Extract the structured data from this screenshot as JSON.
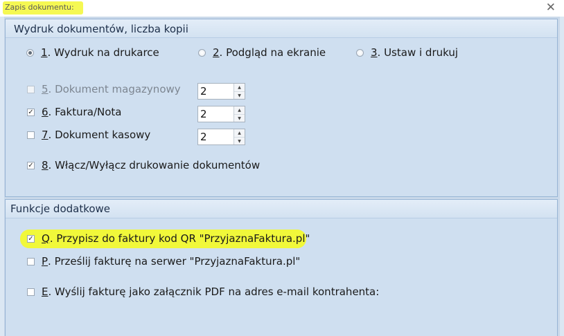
{
  "window": {
    "title": "Zapis dokumentu:",
    "close_glyph": "✕"
  },
  "print_section": {
    "title": "Wydruk dokumentów, liczba kopii",
    "radios": [
      {
        "key": "1",
        "label": ". Wydruk na drukarce",
        "selected": true
      },
      {
        "key": "2",
        "label": ". Podgląd na ekranie",
        "selected": false
      },
      {
        "key": "3",
        "label": ". Ustaw i drukuj",
        "selected": false
      }
    ],
    "checks": [
      {
        "key": "5",
        "label": ". Dokument magazynowy",
        "checked": false,
        "enabled": false,
        "copies": "2"
      },
      {
        "key": "6",
        "label": ". Faktura/Nota",
        "checked": true,
        "enabled": true,
        "copies": "2"
      },
      {
        "key": "7",
        "label": ". Dokument kasowy",
        "checked": false,
        "enabled": true,
        "copies": "2"
      },
      {
        "key": "8",
        "label": ". Włącz/Wyłącz drukowanie dokumentów",
        "checked": true,
        "enabled": true
      }
    ]
  },
  "extra_section": {
    "title": "Funkcje dodatkowe",
    "checks": [
      {
        "key": "Q",
        "label": ". Przypisz do faktury kod QR \"PrzyjaznaFaktura.pl\"",
        "checked": true
      },
      {
        "key": "P",
        "label": ". Prześlij fakturę na serwer \"PrzyjaznaFaktura.pl\"",
        "checked": false
      },
      {
        "key": "E",
        "label": ". Wyślij fakturę jako załącznik PDF na adres e-mail kontrahenta:",
        "checked": false
      }
    ]
  },
  "highlight_color": "#f1f83a",
  "check_glyph": "✓"
}
